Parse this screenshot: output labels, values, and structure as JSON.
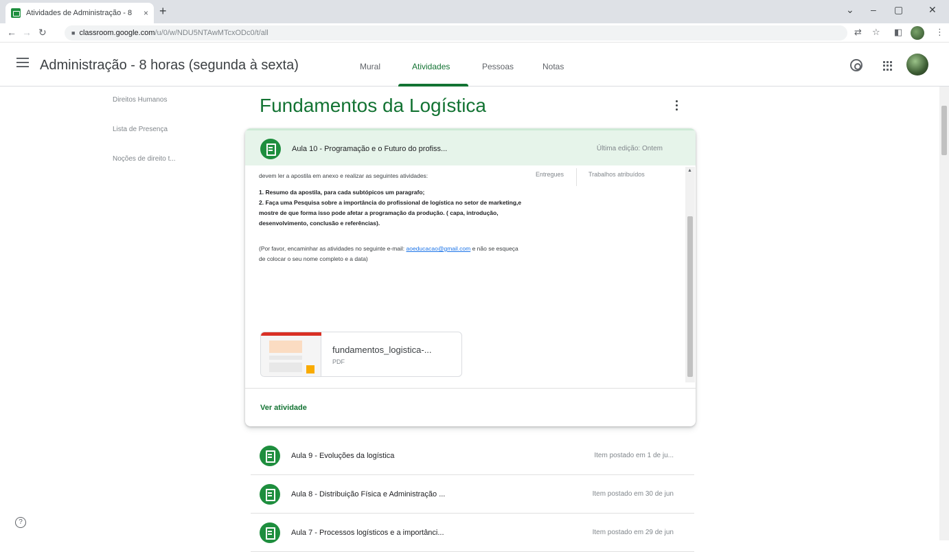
{
  "browser": {
    "tab_title": "Atividades de Administração - 8",
    "tab_close": "×",
    "new_tab": "+",
    "url_host": "classroom.google.com",
    "url_path": "/u/0/w/NDU5NTAwMTcxODc0/t/all",
    "min": "–",
    "max": "▢",
    "close": "✕"
  },
  "header": {
    "course_title": "Administração - 8 horas (segunda à sexta)",
    "tabs": [
      {
        "label": "Mural"
      },
      {
        "label": "Atividades"
      },
      {
        "label": "Pessoas"
      },
      {
        "label": "Notas"
      }
    ]
  },
  "topics": [
    "Direitos Humanos",
    "Lista de Presença",
    "Noções de direito t..."
  ],
  "section": {
    "title": "Fundamentos da Logística"
  },
  "expanded": {
    "title": "Aula 10 - Programação e o Futuro do profiss...",
    "meta": "Última edição: Ontem",
    "intro": "devem ler a apostila em anexo e realizar as seguintes atividades:",
    "item1": "1. Resumo da apostila, para cada subtópicos um paragrafo;",
    "item2": "2. Faça uma Pesquisa sobre a importância do profissional de logística no setor de marketing,e mostre de que forma isso pode afetar a programação da produção. ( capa, introdução, desenvolvimento, conclusão e referências).",
    "note_before": "(Por favor, encaminhar as atividades no seguinte e-mail:",
    "email": "aoeducacao@gmail.com",
    "note_after": "e não se esqueça de colocar o seu nome completo e a data)",
    "stat_delivered": "Entregues",
    "stat_assigned": "Trabalhos atribuídos",
    "attachment_name": "fundamentos_logistica-...",
    "attachment_type": "PDF",
    "view_label": "Ver atividade"
  },
  "rows": [
    {
      "title": "Aula 9 - Evoluções da logística",
      "meta": "Item postado em 1 de ju..."
    },
    {
      "title": "Aula 8 - Distribuição Física e Administração ...",
      "meta": "Item postado em 30 de jun"
    },
    {
      "title": "Aula 7 - Processos logísticos e a importânci...",
      "meta": "Item postado em 29 de jun"
    }
  ],
  "help": "?"
}
